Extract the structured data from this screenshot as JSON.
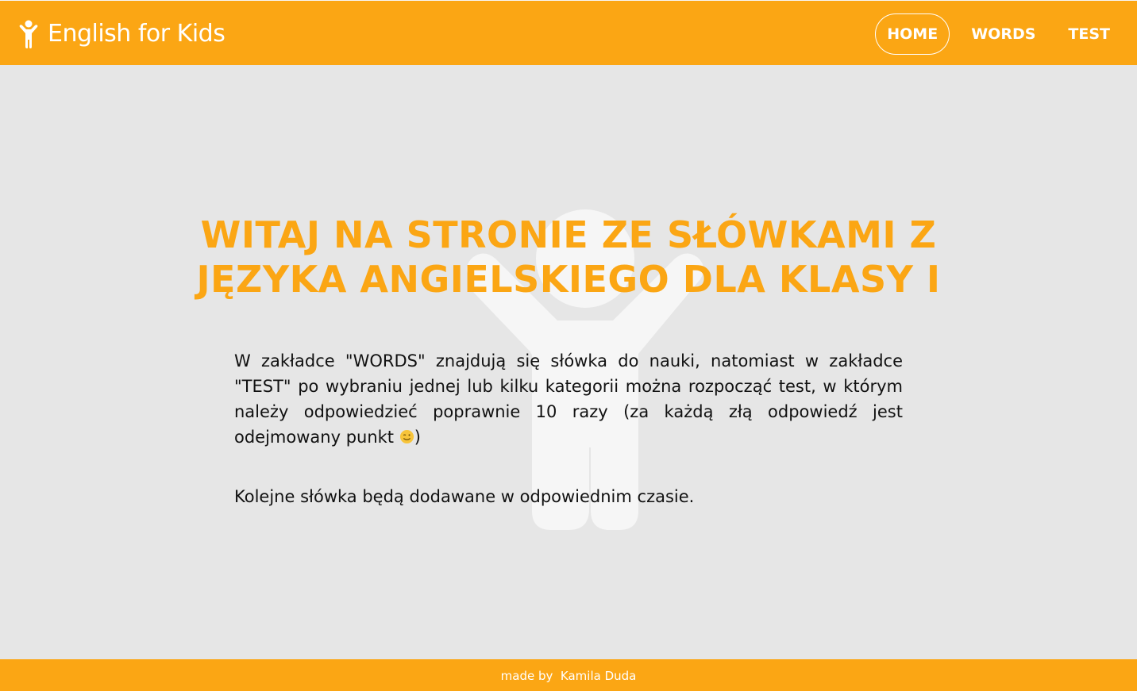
{
  "header": {
    "brand": "English for Kids",
    "nav": [
      {
        "label": "HOME",
        "active": true
      },
      {
        "label": "WORDS",
        "active": false
      },
      {
        "label": "TEST",
        "active": false
      }
    ]
  },
  "main": {
    "title": "WITAJ NA STRONIE ZE SŁÓWKAMI Z JĘZYKA ANGIELSKIEGO DLA KLASY I",
    "paragraph1": "W zakładce \"WORDS\" znajdują się słówka do nauki, natomiast w zakładce \"TEST\" po wybraniu jednej lub kilku kategorii można rozpocząć test, w którym należy odpowiedzieć poprawnie 10 razy (za każdą złą odpowiedź jest odejmowany punkt",
    "paragraph1_end": ")",
    "paragraph2": "Kolejne słówka będą dodawane w odpowiednim czasie."
  },
  "footer": {
    "text": "made by  Kamila Duda"
  },
  "icons": {
    "logo": "child-icon",
    "background": "child-figure-icon",
    "emoji": "wink-emoji-icon"
  },
  "colors": {
    "accent": "#fba614",
    "background": "#e6e6e6",
    "text": "#111111"
  }
}
